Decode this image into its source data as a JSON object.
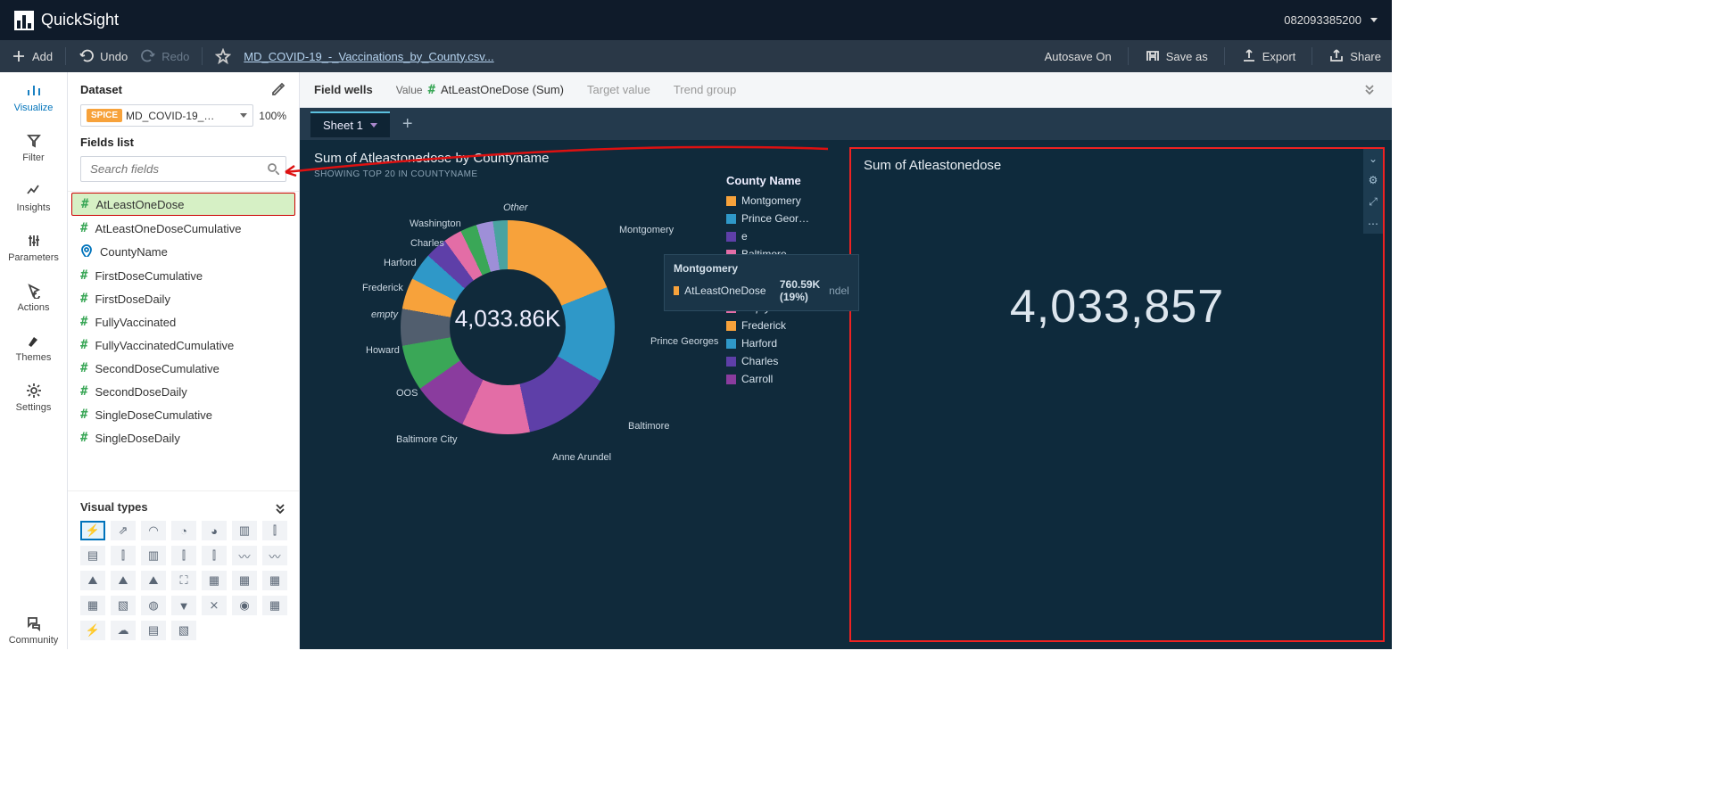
{
  "header": {
    "brand": "QuickSight",
    "account": "082093385200"
  },
  "toolbar": {
    "add": "Add",
    "undo": "Undo",
    "redo": "Redo",
    "title": "MD_COVID-19_-_Vaccinations_by_County.csv...",
    "autosave": "Autosave On",
    "saveas": "Save as",
    "export": "Export",
    "share": "Share"
  },
  "nav": {
    "visualize": "Visualize",
    "filter": "Filter",
    "insights": "Insights",
    "parameters": "Parameters",
    "actions": "Actions",
    "themes": "Themes",
    "settings": "Settings",
    "community": "Community"
  },
  "side": {
    "dataset_head": "Dataset",
    "dataset_name": "MD_COVID-19_…",
    "badge": "SPICE",
    "pct": "100%",
    "fields_head": "Fields list",
    "search_ph": "Search fields",
    "visual_head": "Visual types",
    "fields": [
      {
        "n": "AtLeastOneDose",
        "t": "num",
        "hl": true
      },
      {
        "n": "AtLeastOneDoseCumulative",
        "t": "num"
      },
      {
        "n": "CountyName",
        "t": "geo"
      },
      {
        "n": "FirstDoseCumulative",
        "t": "num"
      },
      {
        "n": "FirstDoseDaily",
        "t": "num"
      },
      {
        "n": "FullyVaccinated",
        "t": "num"
      },
      {
        "n": "FullyVaccinatedCumulative",
        "t": "num"
      },
      {
        "n": "SecondDoseCumulative",
        "t": "num"
      },
      {
        "n": "SecondDoseDaily",
        "t": "num"
      },
      {
        "n": "SingleDoseCumulative",
        "t": "num"
      },
      {
        "n": "SingleDoseDaily",
        "t": "num"
      }
    ]
  },
  "fieldwells": {
    "title": "Field wells",
    "value_label": "Value",
    "value": "AtLeastOneDose (Sum)",
    "target_label": "Target value",
    "trend_label": "Trend group"
  },
  "sheets": {
    "s1": "Sheet 1"
  },
  "donut": {
    "title": "Sum of Atleastonedose by Countyname",
    "sub": "SHOWING TOP 20 IN COUNTYNAME",
    "center": "4,033.86K",
    "labels": {
      "other": "Other",
      "montgomery": "Montgomery",
      "pg": "Prince Georges",
      "baltimore": "Baltimore",
      "aa": "Anne Arundel",
      "bc": "Baltimore City",
      "oos": "OOS",
      "howard": "Howard",
      "empty": "empty",
      "frederick": "Frederick",
      "harford": "Harford",
      "charles": "Charles",
      "washington": "Washington"
    },
    "tooltip": {
      "title": "Montgomery",
      "measure": "AtLeastOneDose",
      "value": "760.59K (19%)"
    },
    "legend_title": "County Name",
    "legend": [
      {
        "c": "#f7a23b",
        "l": "Montgomery"
      },
      {
        "c": "#2f98c8",
        "l": "Prince Geor…"
      },
      {
        "c": "#5e3fa8",
        "l": "e",
        "hidden": true
      },
      {
        "c": "#e36da6",
        "l": "Baltimore …"
      },
      {
        "c": "#2f98c8",
        "l": "OOS"
      },
      {
        "c": "#3aa757",
        "l": "Howard"
      },
      {
        "c": "#e36da6",
        "l": "empty",
        "it": true
      },
      {
        "c": "#f7a23b",
        "l": "Frederick"
      },
      {
        "c": "#2f98c8",
        "l": "Harford"
      },
      {
        "c": "#5e3fa8",
        "l": "Charles"
      },
      {
        "c": "#8a3c9e",
        "l": "Carroll"
      }
    ]
  },
  "kpi": {
    "title": "Sum of Atleastonedose",
    "value": "4,033,857"
  },
  "chart_data": {
    "type": "pie",
    "title": "Sum of Atleastonedose by Countyname",
    "subtitle": "SHOWING TOP 20 IN COUNTYNAME",
    "total_label": "4,033.86K",
    "measure": "AtLeastOneDose (Sum)",
    "slices": [
      {
        "county": "Montgomery",
        "value": 760590,
        "pct": 19
      },
      {
        "county": "Prince Georges",
        "value": 580000,
        "pct": 14.4
      },
      {
        "county": "Baltimore",
        "value": 540000,
        "pct": 13.4
      },
      {
        "county": "Anne Arundel",
        "value": 410000,
        "pct": 10.2
      },
      {
        "county": "Baltimore City",
        "value": 335000,
        "pct": 8.3
      },
      {
        "county": "OOS",
        "value": 280000,
        "pct": 6.9
      },
      {
        "county": "Howard",
        "value": 225000,
        "pct": 5.6
      },
      {
        "county": "empty",
        "value": 190000,
        "pct": 4.7
      },
      {
        "county": "Frederick",
        "value": 170000,
        "pct": 4.2
      },
      {
        "county": "Harford",
        "value": 135000,
        "pct": 3.3
      },
      {
        "county": "Charles",
        "value": 110000,
        "pct": 2.7
      },
      {
        "county": "Washington",
        "value": 100000,
        "pct": 2.5
      },
      {
        "county": "Other",
        "value": 198000,
        "pct": 4.9
      }
    ],
    "kpi": {
      "title": "Sum of Atleastonedose",
      "value": 4033857
    }
  }
}
